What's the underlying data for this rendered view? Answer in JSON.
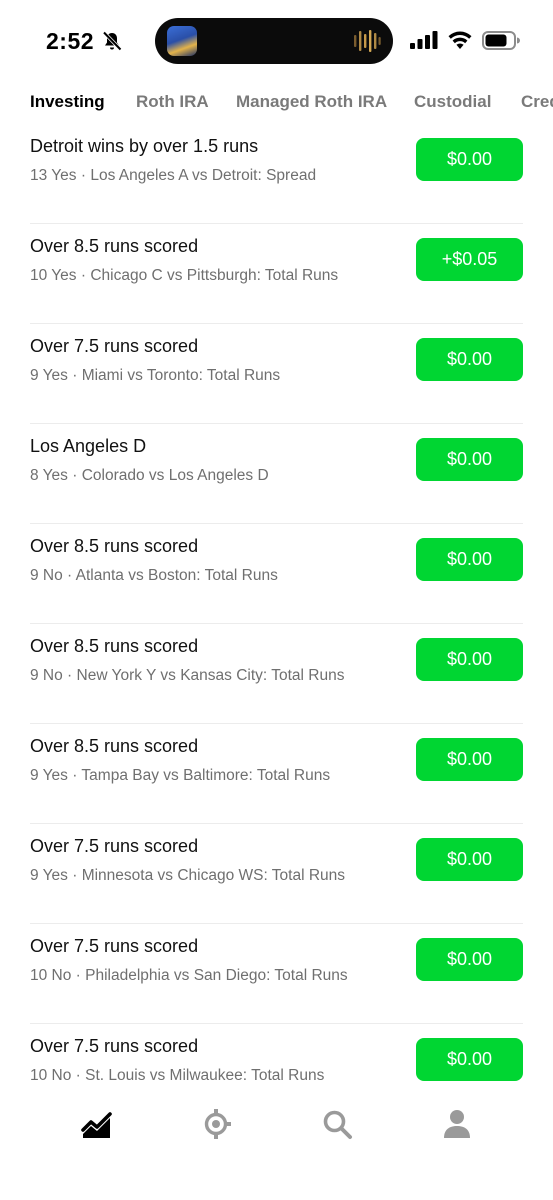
{
  "status": {
    "time": "2:52"
  },
  "tabs": [
    {
      "label": "Investing",
      "active": true
    },
    {
      "label": "Roth IRA",
      "active": false
    },
    {
      "label": "Managed Roth IRA",
      "active": false
    },
    {
      "label": "Custodial",
      "active": false
    },
    {
      "label": "Cred",
      "active": false
    }
  ],
  "rows": [
    {
      "title": "Detroit wins by over 1.5 runs",
      "subtitle": "13 Yes · Los Angeles A vs Detroit: Spread",
      "amount": "$0.00"
    },
    {
      "title": "Over 8.5 runs scored",
      "subtitle": "10 Yes · Chicago C vs Pittsburgh: Total Runs",
      "amount": "+$0.05"
    },
    {
      "title": "Over 7.5 runs scored",
      "subtitle": "9 Yes · Miami vs Toronto: Total Runs",
      "amount": "$0.00"
    },
    {
      "title": "Los Angeles D",
      "subtitle": "8 Yes · Colorado vs Los Angeles D",
      "amount": "$0.00"
    },
    {
      "title": "Over 8.5 runs scored",
      "subtitle": "9 No · Atlanta vs Boston: Total Runs",
      "amount": "$0.00"
    },
    {
      "title": "Over 8.5 runs scored",
      "subtitle": "9 No · New York Y vs Kansas City: Total Runs",
      "amount": "$0.00"
    },
    {
      "title": "Over 8.5 runs scored",
      "subtitle": "9 Yes · Tampa Bay vs Baltimore: Total Runs",
      "amount": "$0.00"
    },
    {
      "title": "Over 7.5 runs scored",
      "subtitle": "9 Yes · Minnesota vs Chicago WS: Total Runs",
      "amount": "$0.00"
    },
    {
      "title": "Over 7.5 runs scored",
      "subtitle": "10 No · Philadelphia vs San Diego: Total Runs",
      "amount": "$0.00"
    },
    {
      "title": "Over 7.5 runs scored",
      "subtitle": "10 No · St. Louis vs Milwaukee: Total Runs",
      "amount": "$0.00"
    }
  ],
  "nav": [
    {
      "icon": "investing-chart-icon",
      "active": true
    },
    {
      "icon": "sports-predictions-icon",
      "active": false
    },
    {
      "icon": "search-icon",
      "active": false
    },
    {
      "icon": "profile-icon",
      "active": false
    }
  ],
  "colors": {
    "accent_green": "#00d632",
    "inactive_gray": "#7a7a7a",
    "active_black": "#000000"
  }
}
